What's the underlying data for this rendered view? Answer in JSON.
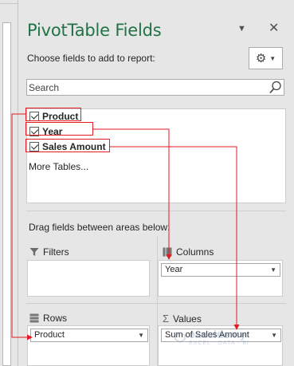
{
  "pane": {
    "title": "PivotTable Fields",
    "choose_label": "Choose fields to add to report:",
    "search_placeholder": "Search",
    "more_tables": "More Tables...",
    "drag_label": "Drag fields between areas below:"
  },
  "fields": [
    {
      "label": "Product",
      "checked": true
    },
    {
      "label": "Year",
      "checked": true
    },
    {
      "label": "Sales Amount",
      "checked": true
    }
  ],
  "areas": {
    "filters": {
      "label": "Filters",
      "items": []
    },
    "columns": {
      "label": "Columns",
      "items": [
        "Year"
      ]
    },
    "rows": {
      "label": "Rows",
      "items": [
        "Product"
      ]
    },
    "values": {
      "label": "Values",
      "items": [
        "Sum of Sales Amount"
      ]
    }
  },
  "icons": [
    "pane-menu-icon",
    "close-icon",
    "gear-icon",
    "search-icon",
    "filter-icon",
    "columns-icon",
    "rows-icon",
    "sigma-icon"
  ],
  "colors": {
    "title": "#217346",
    "annotation": "#e31b23"
  },
  "watermark": {
    "name": "exceldemy",
    "tag": "EXCEL · DATA · BI"
  }
}
